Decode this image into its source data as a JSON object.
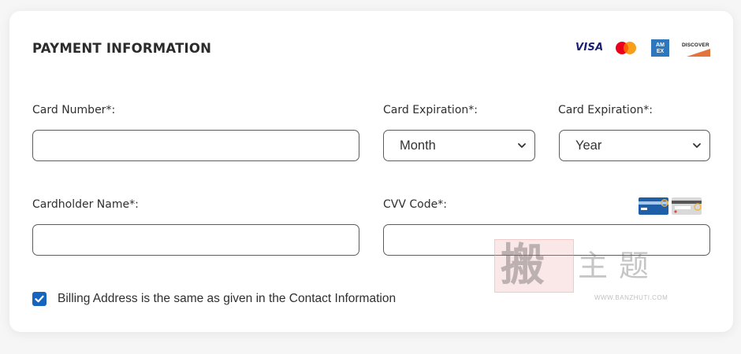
{
  "section": {
    "title": "PAYMENT INFORMATION"
  },
  "card_brands": {
    "visa": "VISA",
    "discover": "DISCOVER",
    "icons": [
      "visa-logo",
      "mastercard-logo",
      "amex-logo",
      "discover-logo"
    ]
  },
  "fields": {
    "card_number": {
      "label": "Card Number*:",
      "value": ""
    },
    "expiration_month": {
      "label": "Card Expiration*:",
      "selected": "Month"
    },
    "expiration_year": {
      "label": "Card Expiration*:",
      "selected": "Year"
    },
    "cardholder_name": {
      "label": "Cardholder Name*:",
      "value": ""
    },
    "cvv": {
      "label": "CVV Code*:",
      "value": ""
    }
  },
  "billing_same": {
    "checked": true,
    "label": "Billing Address is the same as given in the Contact Information"
  },
  "watermark": {
    "big": "搬",
    "text": "主题",
    "url": "WWW.BANZHUTI.COM"
  },
  "colors": {
    "accent": "#1565c0",
    "border": "#5c5c5c",
    "visa": "#1a1f71",
    "amex": "#2e77bc",
    "discover": "#e2743c"
  }
}
